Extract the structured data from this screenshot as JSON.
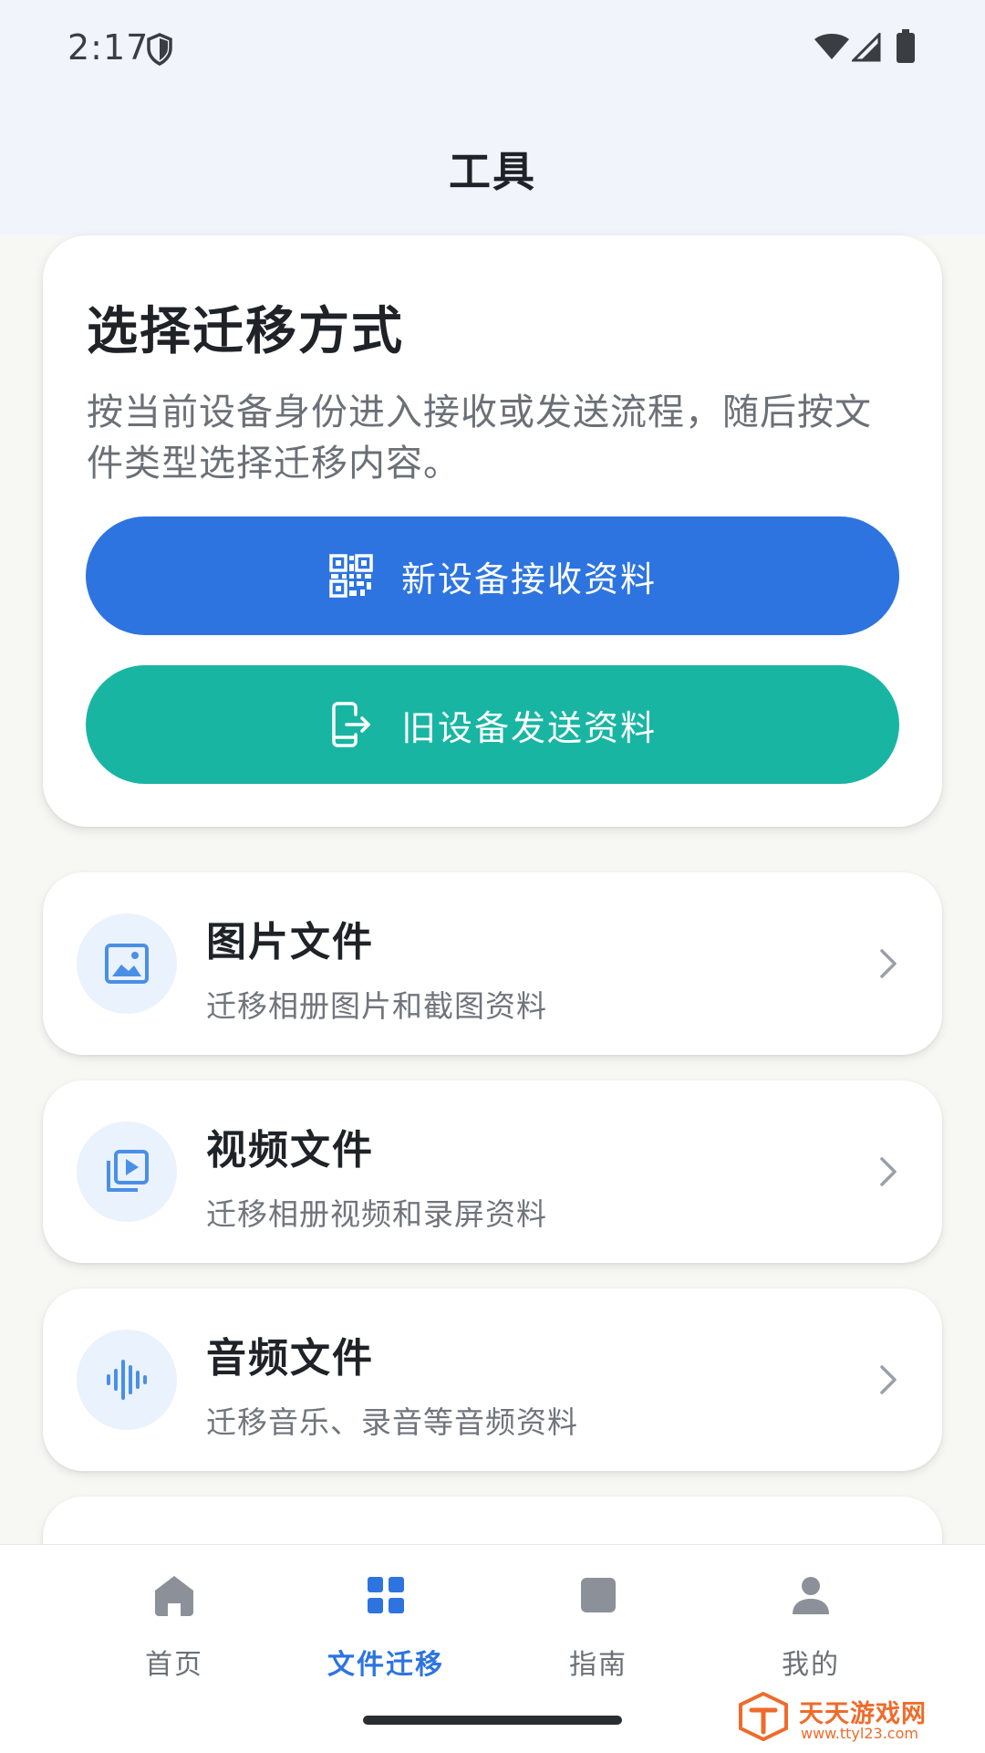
{
  "status_bar": {
    "time": "2:17",
    "icons": [
      "shield-icon",
      "wifi-icon",
      "signal-icon",
      "battery-icon"
    ]
  },
  "header": {
    "title": "工具"
  },
  "migrate": {
    "title": "选择迁移方式",
    "description": "按当前设备身份进入接收或发送流程，随后按文件类型选择迁移内容。",
    "receive_label": "新设备接收资料",
    "receive_icon": "qr-code-icon",
    "send_label": "旧设备发送资料",
    "send_icon": "phone-export-icon"
  },
  "file_types": [
    {
      "title": "图片文件",
      "subtitle": "迁移相册图片和截图资料",
      "icon": "image-icon"
    },
    {
      "title": "视频文件",
      "subtitle": "迁移相册视频和录屏资料",
      "icon": "video-library-icon"
    },
    {
      "title": "音频文件",
      "subtitle": "迁移音乐、录音等音频资料",
      "icon": "audio-wave-icon"
    }
  ],
  "bottom_nav": {
    "items": [
      {
        "label": "首页",
        "icon": "home-icon",
        "active": false
      },
      {
        "label": "文件迁移",
        "icon": "grid-icon",
        "active": true
      },
      {
        "label": "指南",
        "icon": "book-icon",
        "active": false
      },
      {
        "label": "我的",
        "icon": "person-icon",
        "active": false
      }
    ]
  },
  "watermark": {
    "name": "天天游戏网",
    "url": "www.ttyl23.com"
  },
  "colors": {
    "primary_blue": "#2d74e0",
    "teal": "#19b5a3",
    "header_bg": "#f1f4fa",
    "icon_bg": "#eaf2fd",
    "watermark_orange": "#ef6b2b"
  }
}
